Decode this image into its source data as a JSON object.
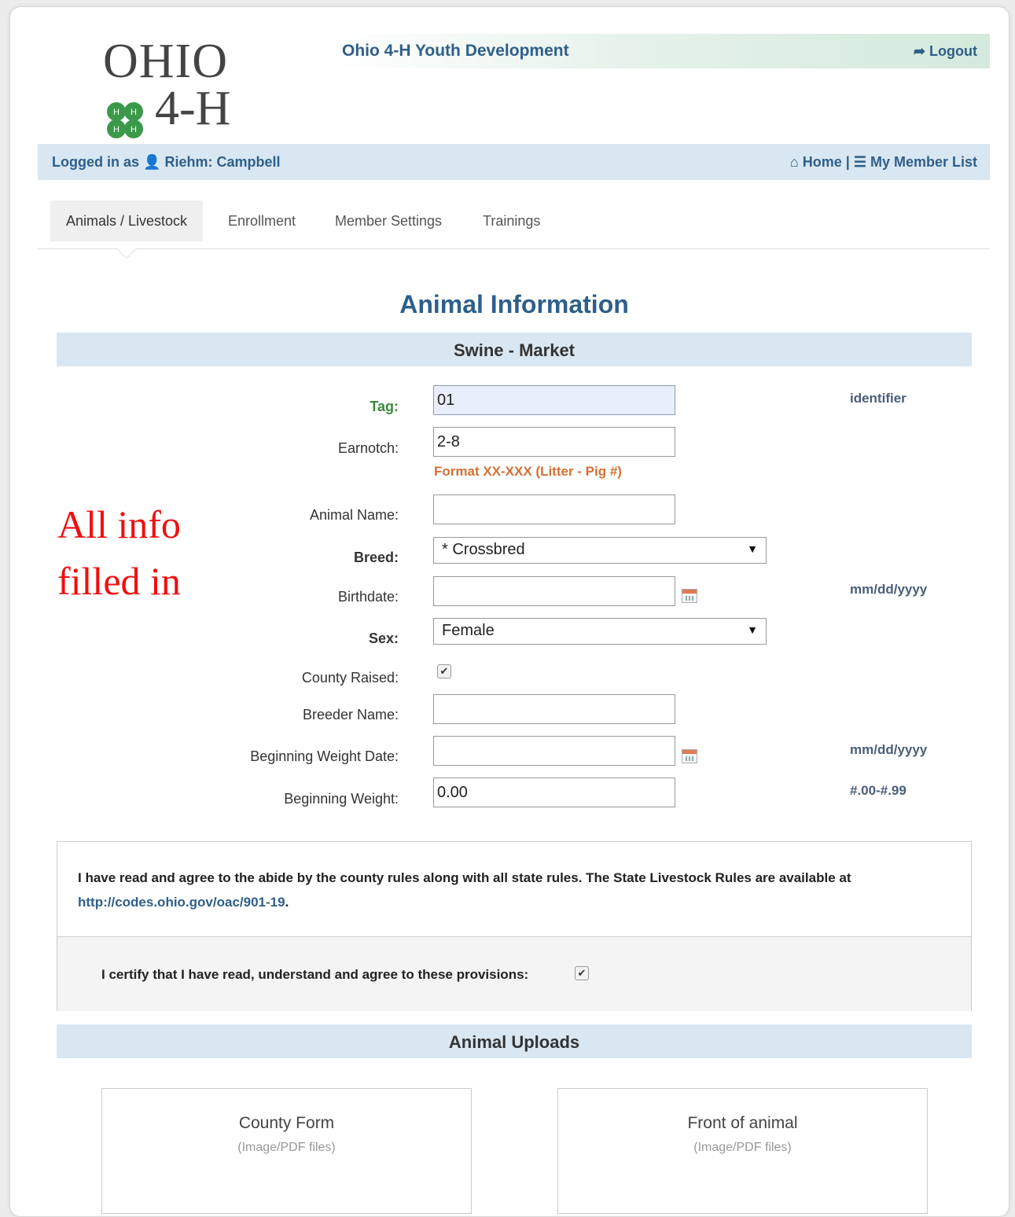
{
  "logo": {
    "ohio": "OHIO",
    "fourh": "4-H"
  },
  "header": {
    "title": "Ohio 4-H Youth Development",
    "logout_label": "Logout"
  },
  "userbar": {
    "logged_in_as": "Logged in as",
    "user_name": "Riehm: Campbell",
    "home_label": "Home",
    "separator": "|",
    "member_list_label": "My Member List"
  },
  "tabs": [
    {
      "label": "Animals / Livestock",
      "active": true
    },
    {
      "label": "Enrollment"
    },
    {
      "label": "Member Settings"
    },
    {
      "label": "Trainings"
    }
  ],
  "page_title": "Animal Information",
  "section_title": "Swine - Market",
  "form": {
    "tag": {
      "label": "Tag:",
      "value": "01",
      "hint": "identifier"
    },
    "earnotch": {
      "label": "Earnotch:",
      "value": "2-8",
      "format": "Format XX-XXX (Litter - Pig #)"
    },
    "animal_name": {
      "label": "Animal Name:",
      "value": ""
    },
    "breed": {
      "label": "Breed:",
      "value": "* Crossbred"
    },
    "birthdate": {
      "label": "Birthdate:",
      "value": "",
      "hint": "mm/dd/yyyy"
    },
    "sex": {
      "label": "Sex:",
      "value": "Female"
    },
    "county_raised": {
      "label": "County Raised:",
      "checked": true
    },
    "breeder_name": {
      "label": "Breeder Name:",
      "value": ""
    },
    "beginning_weight_date": {
      "label": "Beginning Weight Date:",
      "value": "",
      "hint": "mm/dd/yyyy"
    },
    "beginning_weight": {
      "label": "Beginning Weight:",
      "value": "0.00",
      "hint": "#.00-#.99"
    }
  },
  "annotation": {
    "line1": "All info",
    "line2": "filled in"
  },
  "rules": {
    "text_before_link": "I have read and agree to the abide by the county rules along with all state rules. The State Livestock Rules are available at ",
    "link": "http://codes.ohio.gov/oac/901-19",
    "text_after_link": ".",
    "certify_label": "I certify that I have read, understand and agree to these provisions:",
    "certify_checked": true
  },
  "uploads": {
    "title": "Animal Uploads",
    "boxes": [
      {
        "title": "County Form",
        "subtitle": "(Image/PDF files)"
      },
      {
        "title": "Front of animal",
        "subtitle": "(Image/PDF files)"
      }
    ]
  },
  "colors": {
    "accent": "#2e5f8a",
    "band": "#d9e7f2",
    "format_orange": "#d47034",
    "annotation_red": "#f01010",
    "clover_green": "#3a9a4a"
  }
}
